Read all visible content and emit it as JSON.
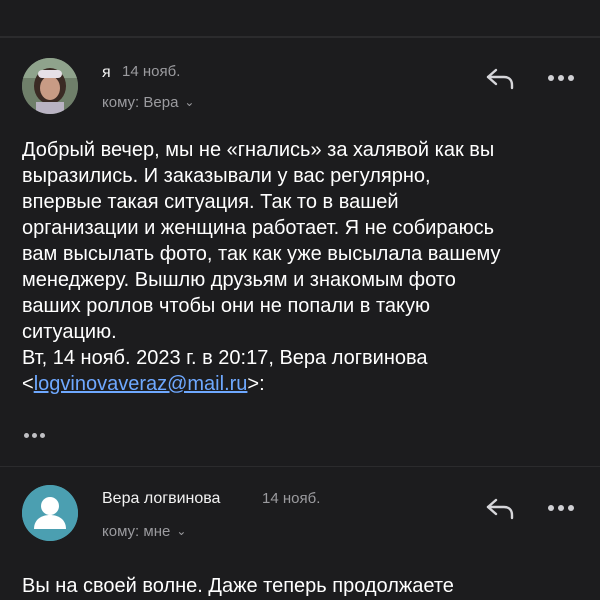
{
  "messages": [
    {
      "sender": "я",
      "date": "14 нояб.",
      "to_label": "кому: Вера",
      "body_lines": [
        "Добрый вечер, мы не «гнались» за халявой как вы",
        "выразились. И заказывали у вас регулярно,",
        "впервые такая ситуация. Так то в вашей",
        "организации и женщина работает. Я не собираюсь",
        "вам высылать фото, так как уже высылала вашему",
        "менеджеру. Вышлю друзьям и знакомым фото",
        "ваших роллов чтобы они не попали в такую",
        "ситуацию."
      ],
      "quote_header": "Вт, 14 нояб. 2023 г. в 20:17, Вера логвинова",
      "quote_email_prefix": "<",
      "quote_email": "logvinovaveraz@mail.ru",
      "quote_email_suffix": ">:"
    },
    {
      "sender": "Вера логвинова",
      "date": "14 нояб.",
      "to_label": "кому: мне",
      "body_lines": [
        "Вы на своей волне. Даже теперь продолжаете"
      ]
    }
  ],
  "icons": {
    "reply": "reply-icon",
    "more": "more-icon",
    "chevron": "chevron-down-icon",
    "avatar_placeholder": "person-icon"
  },
  "colors": {
    "background": "#1c1c1e",
    "link": "#6ea8ff",
    "secondary_text": "#9b9b9f",
    "avatar_teal": "#4b9fb1"
  }
}
